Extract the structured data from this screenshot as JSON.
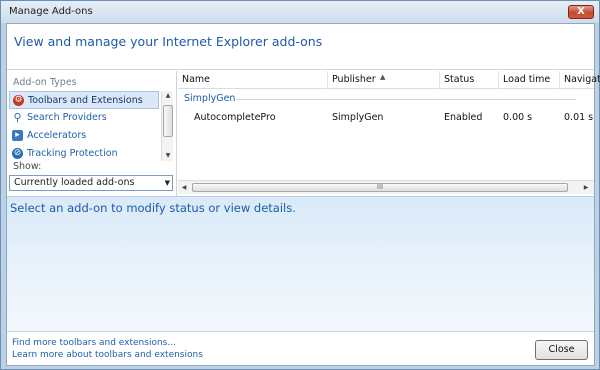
{
  "window": {
    "title": "Manage Add-ons",
    "close_glyph": "X"
  },
  "header": {
    "text": "View and manage your Internet Explorer add-ons"
  },
  "sidebar": {
    "types_label": "Add-on Types",
    "items": [
      {
        "label": "Toolbars and Extensions",
        "icon": "toolbar-gear-icon",
        "selected": true
      },
      {
        "label": "Search Providers",
        "icon": "search-icon",
        "selected": false
      },
      {
        "label": "Accelerators",
        "icon": "accelerator-icon",
        "selected": false
      },
      {
        "label": "Tracking Protection",
        "icon": "no-tracking-icon",
        "selected": false
      }
    ],
    "show_label": "Show:",
    "show_value": "Currently loaded add-ons"
  },
  "table": {
    "columns": [
      "Name",
      "Publisher",
      "Status",
      "Load time",
      "Navigati"
    ],
    "group": "SimplyGen",
    "rows": [
      {
        "name": "AutocompletePro",
        "publisher": "SimplyGen",
        "status": "Enabled",
        "load_time": "0.00 s",
        "navigation": "0.01 s"
      }
    ]
  },
  "details": {
    "text": "Select an add-on to modify status or view details."
  },
  "footer": {
    "link1": "Find more toolbars and extensions...",
    "link2": "Learn more about toolbars and extensions",
    "close_label": "Close"
  },
  "colors": {
    "accent": "#1e5aa8",
    "selection": "#dbe8f7"
  }
}
